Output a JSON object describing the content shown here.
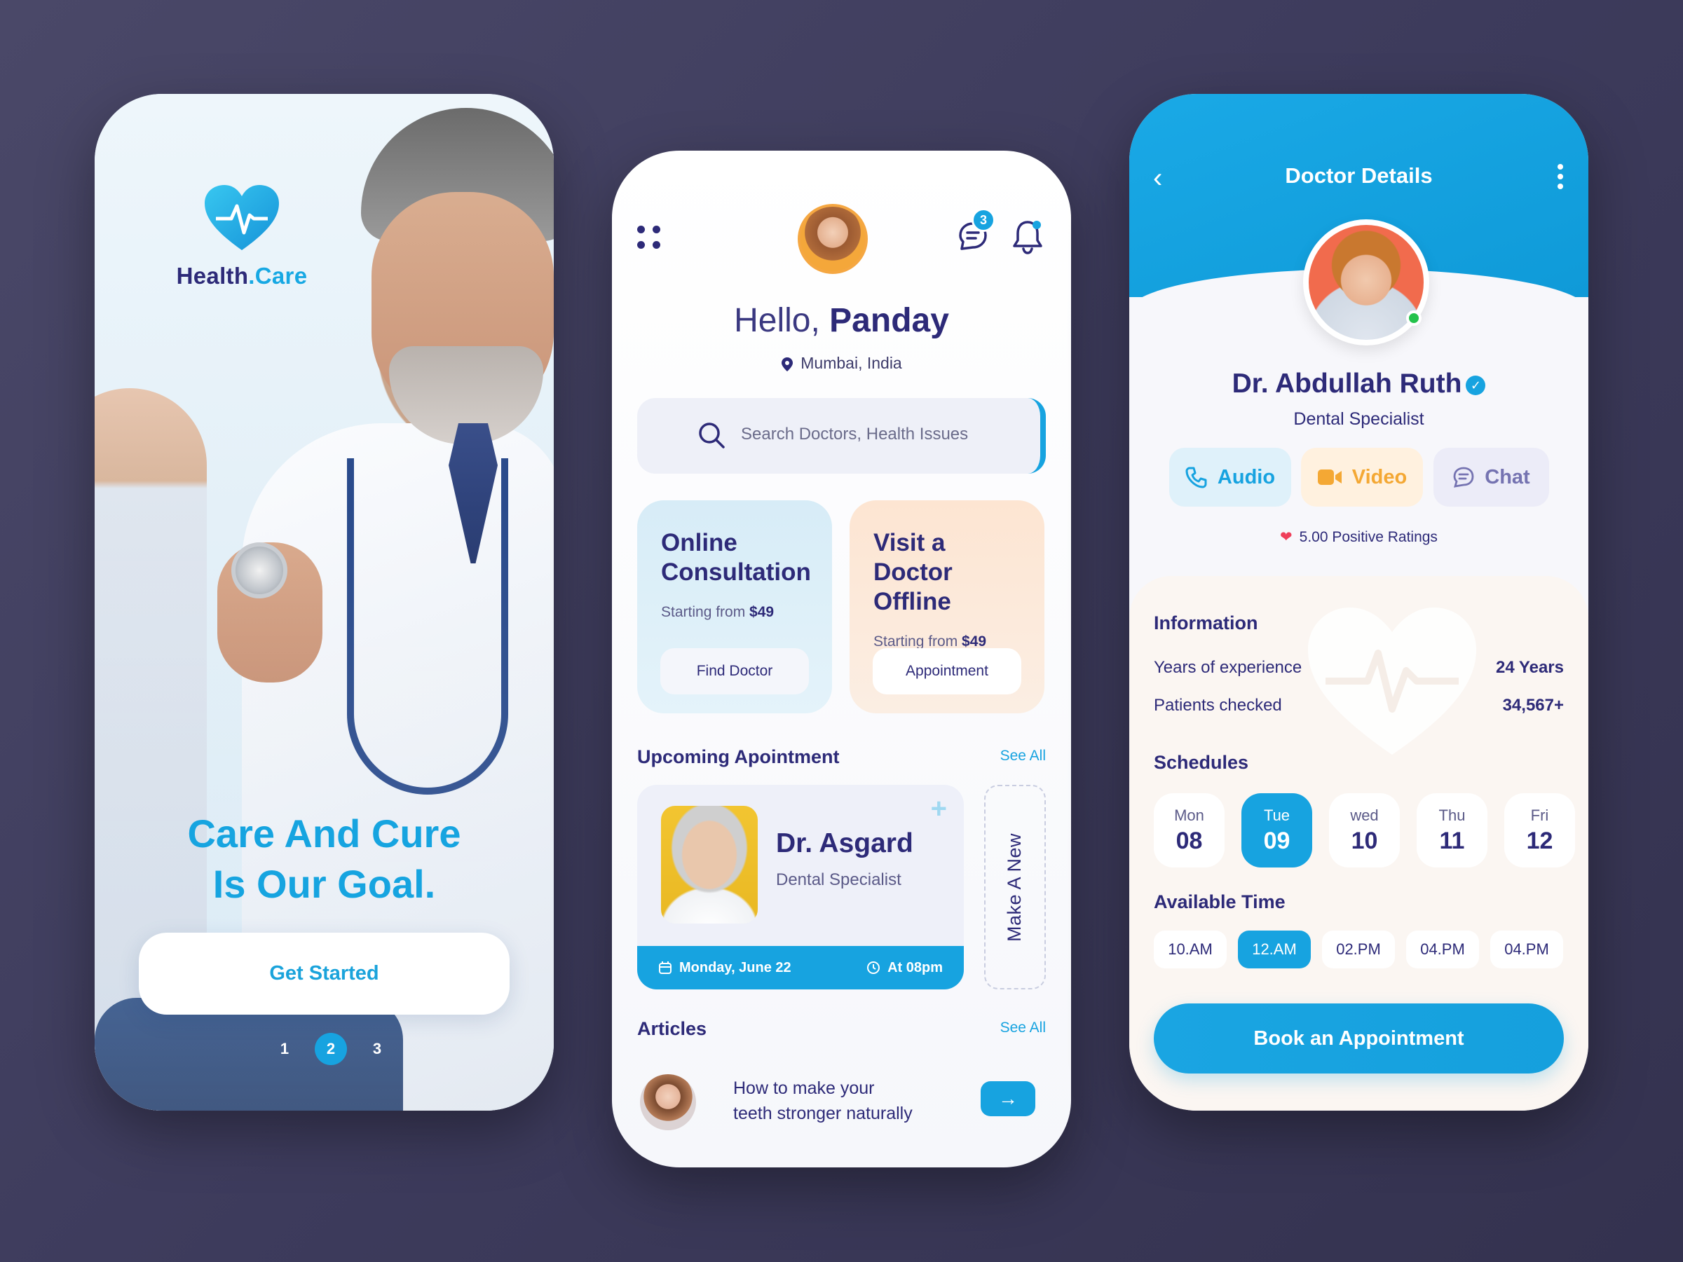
{
  "onboarding": {
    "brand_first": "Health",
    "brand_dot": ".",
    "brand_second": "Care",
    "tagline_line1": "Care And Cure",
    "tagline_line2": "Is Our Goal.",
    "cta_label": "Get Started",
    "pager": [
      "1",
      "2",
      "3"
    ],
    "pager_active_index": 1
  },
  "home": {
    "greeting_prefix": "Hello, ",
    "user_name": "Panday",
    "location": "Mumbai, India",
    "message_badge": "3",
    "search_placeholder": "Search Doctors, Health Issues",
    "cards": [
      {
        "title_line1": "Online",
        "title_line2": "Consultation",
        "price_prefix": "Starting from ",
        "price": "$49",
        "button": "Find Doctor"
      },
      {
        "title_line1": "Visit a Doctor",
        "title_line2": "Offline",
        "price_prefix": "Starting from ",
        "price": "$49",
        "button": "Appointment"
      }
    ],
    "upcoming_title": "Upcoming Apointment",
    "see_all": "See All",
    "appointment": {
      "doctor": "Dr. Asgard",
      "specialty": "Dental Specialist",
      "date": "Monday, June 22",
      "time": "At 08pm"
    },
    "make_new": "Make A New",
    "articles_title": "Articles",
    "articles_see_all": "See All",
    "article": {
      "line1": "How to make your",
      "line2": "teeth stronger naturally"
    }
  },
  "details": {
    "title": "Doctor Details",
    "doctor_name": "Dr. Abdullah Ruth",
    "specialty": "Dental Specialist",
    "actions": [
      "Audio",
      "Video",
      "Chat"
    ],
    "ratings": "5.00 Positive Ratings",
    "info_title": "Information",
    "info": [
      {
        "label": "Years of experience",
        "value": "24 Years"
      },
      {
        "label": "Patients checked",
        "value": "34,567+"
      }
    ],
    "schedules_title": "Schedules",
    "days": [
      {
        "name": "Mon",
        "date": "08"
      },
      {
        "name": "Tue",
        "date": "09"
      },
      {
        "name": "wed",
        "date": "10"
      },
      {
        "name": "Thu",
        "date": "11"
      },
      {
        "name": "Fri",
        "date": "12"
      }
    ],
    "active_day_index": 1,
    "available_title": "Available Time",
    "times": [
      "10.AM",
      "12.AM",
      "02.PM",
      "04.PM",
      "04.PM"
    ],
    "active_time_index": 1,
    "book_button": "Book an Appointment"
  },
  "colors": {
    "accent": "#17a3e0",
    "navy": "#2d2a78",
    "background": "#3d3b5c",
    "orange": "#f4a834"
  }
}
